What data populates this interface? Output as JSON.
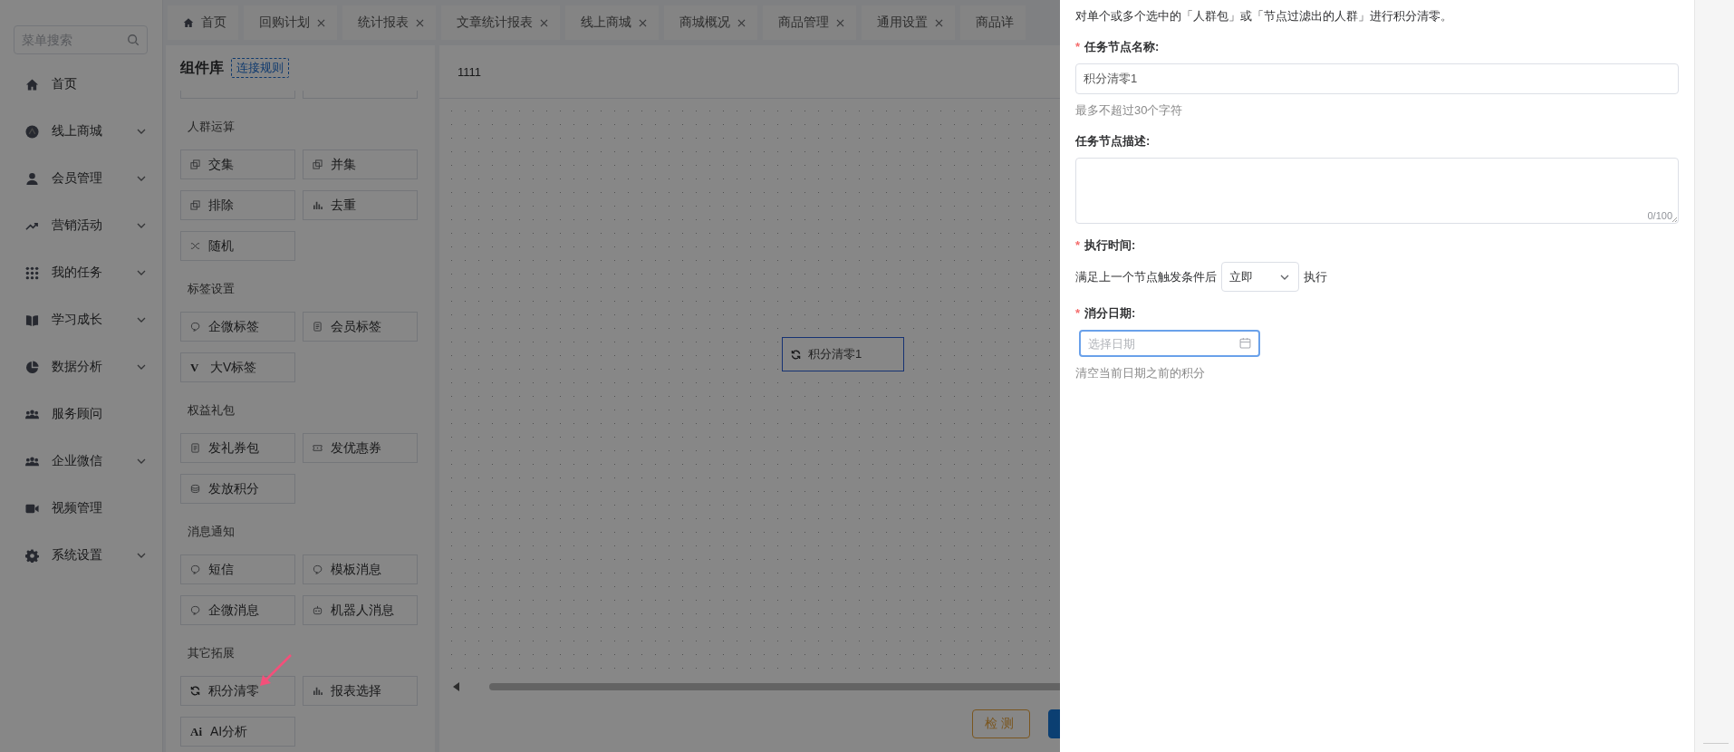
{
  "sidebar": {
    "search": {
      "placeholder": "菜单搜索"
    },
    "items": [
      {
        "label": "首页",
        "expandable": false
      },
      {
        "label": "线上商城",
        "expandable": true
      },
      {
        "label": "会员管理",
        "expandable": true
      },
      {
        "label": "营销活动",
        "expandable": true
      },
      {
        "label": "我的任务",
        "expandable": true
      },
      {
        "label": "学习成长",
        "expandable": true
      },
      {
        "label": "数据分析",
        "expandable": true
      },
      {
        "label": "服务顾问",
        "expandable": false
      },
      {
        "label": "企业微信",
        "expandable": true
      },
      {
        "label": "视频管理",
        "expandable": false
      },
      {
        "label": "系统设置",
        "expandable": true
      }
    ]
  },
  "tabs": [
    {
      "label": "首页",
      "closable": false
    },
    {
      "label": "回购计划",
      "closable": true
    },
    {
      "label": "统计报表",
      "closable": true
    },
    {
      "label": "文章统计报表",
      "closable": true
    },
    {
      "label": "线上商城",
      "closable": true
    },
    {
      "label": "商城概况",
      "closable": true
    },
    {
      "label": "商品管理",
      "closable": true
    },
    {
      "label": "通用设置",
      "closable": true
    },
    {
      "label": "商品详",
      "closable": false
    }
  ],
  "component_library": {
    "title": "组件库",
    "rules_link": "连接规则",
    "groups": [
      {
        "title": "人群运算",
        "items": [
          {
            "label": "交集"
          },
          {
            "label": "并集"
          },
          {
            "label": "排除"
          },
          {
            "label": "去重"
          },
          {
            "label": "随机"
          }
        ]
      },
      {
        "title": "标签设置",
        "items": [
          {
            "label": "企微标签"
          },
          {
            "label": "会员标签"
          },
          {
            "label": "大V标签",
            "glyph": "V"
          }
        ]
      },
      {
        "title": "权益礼包",
        "items": [
          {
            "label": "发礼券包"
          },
          {
            "label": "发优惠券"
          },
          {
            "label": "发放积分"
          }
        ]
      },
      {
        "title": "消息通知",
        "items": [
          {
            "label": "短信"
          },
          {
            "label": "模板消息"
          },
          {
            "label": "企微消息"
          },
          {
            "label": "机器人消息"
          }
        ]
      },
      {
        "title": "其它拓展",
        "items": [
          {
            "label": "积分清零"
          },
          {
            "label": "报表选择"
          },
          {
            "label": "AI分析",
            "glyph": "Ai"
          }
        ]
      }
    ]
  },
  "canvas": {
    "title": "1111",
    "nodes": [
      {
        "label": "积分清零1"
      }
    ],
    "buttons": [
      {
        "kind": "outline",
        "label": "检测"
      },
      {
        "kind": "primary"
      }
    ]
  },
  "drawer": {
    "intro": "对单个或多个选中的「人群包」或「节点过滤出的人群」进行积分清零。",
    "fields": [
      {
        "kind": "input",
        "required_mark": "*",
        "label": "任务节点名称:",
        "value": "积分清零1",
        "hint": "最多不超过30个字符"
      },
      {
        "kind": "textarea",
        "label": "任务节点描述:",
        "counter": "0/100"
      },
      {
        "kind": "timing",
        "required_mark": "*",
        "label": "执行时间:",
        "before": "满足上一个节点触发条件后",
        "select": "立即",
        "after": "执行"
      },
      {
        "kind": "date",
        "required_mark": "*",
        "label": "消分日期:",
        "placeholder": "选择日期",
        "focused": true,
        "hint": "清空当前日期之前的积分"
      }
    ]
  }
}
